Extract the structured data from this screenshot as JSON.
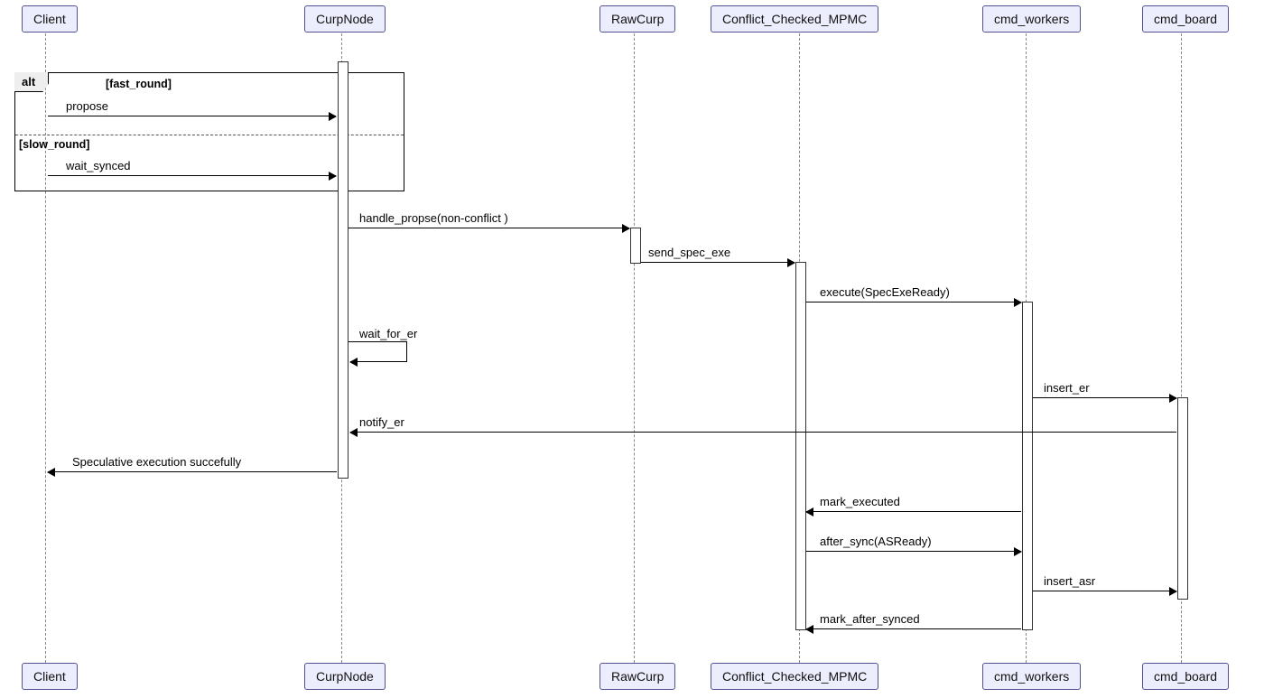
{
  "participants": {
    "client": "Client",
    "curpnode": "CurpNode",
    "rawcurp": "RawCurp",
    "mpmc": "Conflict_Checked_MPMC",
    "workers": "cmd_workers",
    "board": "cmd_board"
  },
  "alt": {
    "keyword": "alt",
    "guard1": "[fast_round]",
    "guard2": "[slow_round]"
  },
  "messages": {
    "propose": "propose",
    "wait_synced": "wait_synced",
    "handle_propose": "handle_propse(non-conflict )",
    "send_spec_exe": "send_spec_exe",
    "execute": "execute(SpecExeReady)",
    "wait_for_er": "wait_for_er",
    "insert_er": "insert_er",
    "notify_er": "notify_er",
    "spec_exec_success": "Speculative execution succefully",
    "mark_executed": "mark_executed",
    "after_sync": "after_sync(ASReady)",
    "insert_asr": "insert_asr",
    "mark_after_synced": "mark_after_synced"
  },
  "chart_data": {
    "type": "sequence_diagram",
    "participants": [
      "Client",
      "CurpNode",
      "RawCurp",
      "Conflict_Checked_MPMC",
      "cmd_workers",
      "cmd_board"
    ],
    "fragments": [
      {
        "type": "alt",
        "operands": [
          {
            "guard": "fast_round",
            "messages": [
              {
                "from": "Client",
                "to": "CurpNode",
                "label": "propose"
              }
            ]
          },
          {
            "guard": "slow_round",
            "messages": [
              {
                "from": "Client",
                "to": "CurpNode",
                "label": "wait_synced"
              }
            ]
          }
        ]
      }
    ],
    "messages": [
      {
        "from": "CurpNode",
        "to": "RawCurp",
        "label": "handle_propse(non-conflict )"
      },
      {
        "from": "RawCurp",
        "to": "Conflict_Checked_MPMC",
        "label": "send_spec_exe"
      },
      {
        "from": "Conflict_Checked_MPMC",
        "to": "cmd_workers",
        "label": "execute(SpecExeReady)"
      },
      {
        "from": "CurpNode",
        "to": "CurpNode",
        "label": "wait_for_er",
        "self": true
      },
      {
        "from": "cmd_workers",
        "to": "cmd_board",
        "label": "insert_er"
      },
      {
        "from": "cmd_board",
        "to": "CurpNode",
        "label": "notify_er"
      },
      {
        "from": "CurpNode",
        "to": "Client",
        "label": "Speculative execution succefully"
      },
      {
        "from": "cmd_workers",
        "to": "Conflict_Checked_MPMC",
        "label": "mark_executed"
      },
      {
        "from": "Conflict_Checked_MPMC",
        "to": "cmd_workers",
        "label": "after_sync(ASReady)"
      },
      {
        "from": "cmd_workers",
        "to": "cmd_board",
        "label": "insert_asr"
      },
      {
        "from": "cmd_workers",
        "to": "Conflict_Checked_MPMC",
        "label": "mark_after_synced"
      }
    ]
  }
}
